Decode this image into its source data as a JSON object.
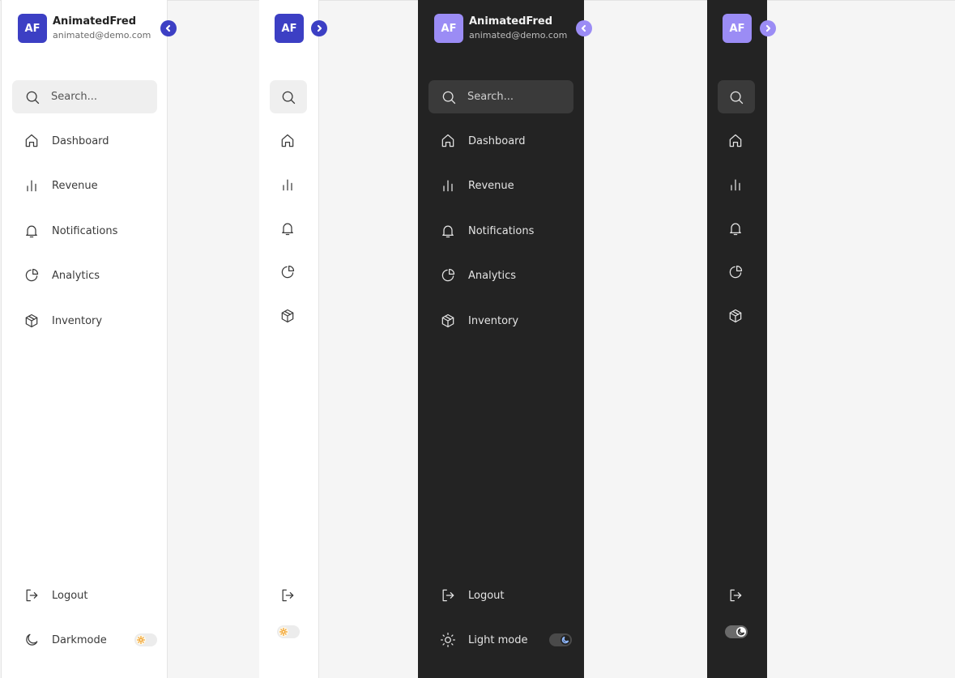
{
  "user": {
    "initials": "AF",
    "name": "AnimatedFred",
    "email": "animated@demo.com"
  },
  "search": {
    "placeholder": "Search..."
  },
  "nav": [
    {
      "label": "Dashboard",
      "icon": "home-icon"
    },
    {
      "label": "Revenue",
      "icon": "bar-chart-icon"
    },
    {
      "label": "Notifications",
      "icon": "bell-icon"
    },
    {
      "label": "Analytics",
      "icon": "pie-chart-icon"
    },
    {
      "label": "Inventory",
      "icon": "box-icon"
    }
  ],
  "footer": {
    "logout_label": "Logout",
    "darkmode_label": "Darkmode",
    "lightmode_label": "Light mode"
  },
  "theme": {
    "light_accent": "#3c3fc4",
    "dark_accent": "#9b8cf5",
    "dark_bg": "#232323",
    "light_bg": "#ffffff",
    "page_bg": "#f5f5f5"
  }
}
